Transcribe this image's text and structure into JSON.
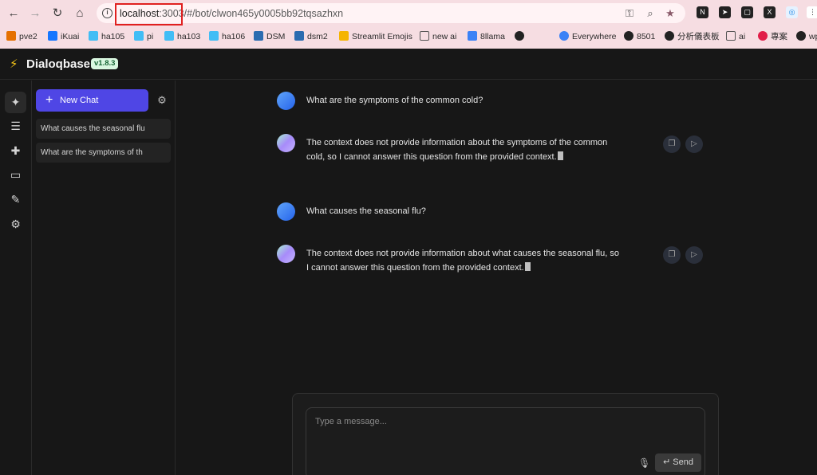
{
  "browser": {
    "url_host": "localhost",
    "url_port": ":3003/",
    "url_path": "#/bot/clwon465y0005bb92tqsazhxn",
    "nav": {
      "back_icon": "←",
      "forward_icon": "→",
      "reload_icon": "↻",
      "home_icon": "⌂"
    },
    "bookmarks": [
      {
        "label": "pve2",
        "color": "#e57000"
      },
      {
        "label": "iKuai",
        "color": "#1677ff"
      },
      {
        "label": "ha105",
        "color": "#41bdf5"
      },
      {
        "label": "pi",
        "color": "#41bdf5"
      },
      {
        "label": "ha103",
        "color": "#41bdf5"
      },
      {
        "label": "ha106",
        "color": "#41bdf5"
      },
      {
        "label": "DSM",
        "color": "#2b6cb0"
      },
      {
        "label": "dsm2",
        "color": "#2b6cb0"
      },
      {
        "label": "Streamlit Emojis",
        "color": "#f5b400"
      },
      {
        "label": "new ai",
        "color": "#555555"
      },
      {
        "label": "8llama",
        "color": "#3b82f6"
      },
      {
        "label": "",
        "color": "#222222"
      },
      {
        "label": "Everywhere",
        "color": "#3b82f6"
      },
      {
        "label": "8501",
        "color": "#222222"
      },
      {
        "label": "分析儀表板",
        "color": "#222222"
      },
      {
        "label": "ai",
        "color": "#555555"
      },
      {
        "label": "專案",
        "color": "#e11d48"
      },
      {
        "label": "wp",
        "color": "#222222"
      }
    ]
  },
  "app": {
    "name": "Dialoqbase",
    "version": "v1.8.3",
    "accent": "#4f46e5"
  },
  "rail": {
    "items": [
      {
        "name": "sparkles-icon",
        "glyph": "✦"
      },
      {
        "name": "database-icon",
        "glyph": "☰"
      },
      {
        "name": "puzzle-icon",
        "glyph": "✚"
      },
      {
        "name": "chat-bubbles-icon",
        "glyph": "▭"
      },
      {
        "name": "pipette-icon",
        "glyph": "✎"
      },
      {
        "name": "settings-icon",
        "glyph": "⚙"
      }
    ]
  },
  "sidebar": {
    "new_chat_label": "New Chat",
    "chats": [
      {
        "title": "What causes the seasonal flu"
      },
      {
        "title": "What are the symptoms of th"
      }
    ]
  },
  "conversation": [
    {
      "role": "user",
      "text": "What are the symptoms of the common cold?"
    },
    {
      "role": "bot",
      "line1": "The context does not provide information about the symptoms of the common",
      "line2": "cold, so I cannot answer this question from the provided context."
    },
    {
      "role": "user",
      "text": "What causes the seasonal flu?"
    },
    {
      "role": "bot",
      "line1": "The context does not provide information about what causes the seasonal flu, so",
      "line2": "I cannot answer this question from the provided context."
    }
  ],
  "composer": {
    "placeholder": "Type a message...",
    "send_label": "Send",
    "send_icon": "↵"
  }
}
